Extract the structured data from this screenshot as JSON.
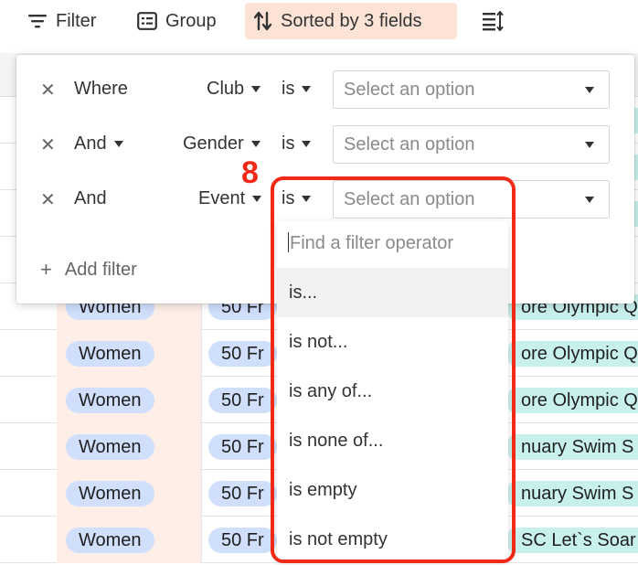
{
  "toolbar": {
    "filter_label": "Filter",
    "group_label": "Group",
    "sorted_label": "Sorted by 3 fields",
    "icons": {
      "filter": "filter-lines-icon",
      "group": "group-list-icon",
      "sort": "sort-arrows-icon",
      "row_height": "row-height-icon"
    },
    "colors": {
      "sorted_bg": "#fde3d6"
    }
  },
  "filters": {
    "rows": [
      {
        "conjunction": "Where",
        "field": "Club",
        "operator": "is",
        "value_placeholder": "Select an option"
      },
      {
        "conjunction": "And",
        "field": "Gender",
        "operator": "is",
        "value_placeholder": "Select an option"
      },
      {
        "conjunction": "And",
        "field": "Event",
        "operator": "is",
        "value_placeholder": "Select an option"
      }
    ],
    "add_filter_label": "Add filter"
  },
  "operator_dropdown": {
    "search_placeholder": "Find a filter operator",
    "options": [
      "is...",
      "is not...",
      "is any of...",
      "is none of...",
      "is empty",
      "is not empty"
    ],
    "highlighted_index": 0
  },
  "annotation": {
    "step_number": "8",
    "color": "#f02a16"
  },
  "table": {
    "rows": [
      {
        "gender": "Women",
        "event": "50 Fr",
        "competition": "ore Olympic Q"
      },
      {
        "gender": "Women",
        "event": "50 Fr",
        "competition": "ore Olympic Q"
      },
      {
        "gender": "Women",
        "event": "50 Fr",
        "competition": "ore Olympic Q"
      },
      {
        "gender": "Women",
        "event": "50 Fr",
        "competition": "nuary Swim S"
      },
      {
        "gender": "Women",
        "event": "50 Fr",
        "competition": "nuary Swim S"
      },
      {
        "gender": "Women",
        "event": "50 Fr",
        "competition": "SC Let`s Soar"
      }
    ],
    "colors": {
      "gender_pill": "#cfdffc",
      "competition_pill": "#c8f0ec",
      "gender_col_bg": "#fdeee8"
    }
  }
}
